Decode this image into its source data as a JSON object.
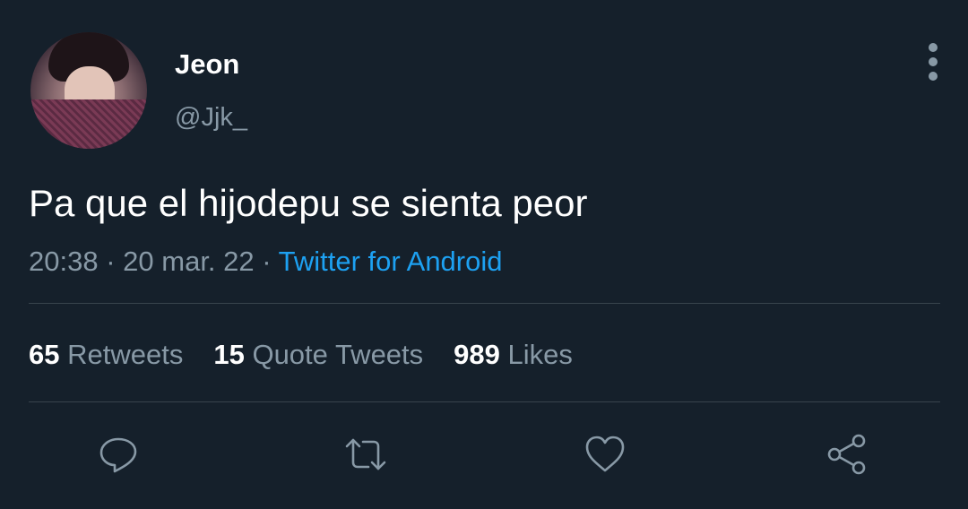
{
  "author": {
    "name": "Jeon",
    "handle": "@Jjk_"
  },
  "tweet": {
    "text": "Pa que el hijodepu se sienta peor",
    "time": "20:38",
    "date": "20 mar. 22",
    "separator": "·",
    "source": "Twitter for Android"
  },
  "stats": {
    "retweets": {
      "count": "65",
      "label": "Retweets"
    },
    "quotes": {
      "count": "15",
      "label": "Quote Tweets"
    },
    "likes": {
      "count": "989",
      "label": "Likes"
    }
  },
  "actions": [
    {
      "icon": "reply-icon"
    },
    {
      "icon": "retweet-icon"
    },
    {
      "icon": "like-icon"
    },
    {
      "icon": "share-icon"
    }
  ],
  "colors": {
    "background": "#15202b",
    "secondary_text": "#8899a6",
    "link": "#1da1f2",
    "divider": "#38444d"
  }
}
